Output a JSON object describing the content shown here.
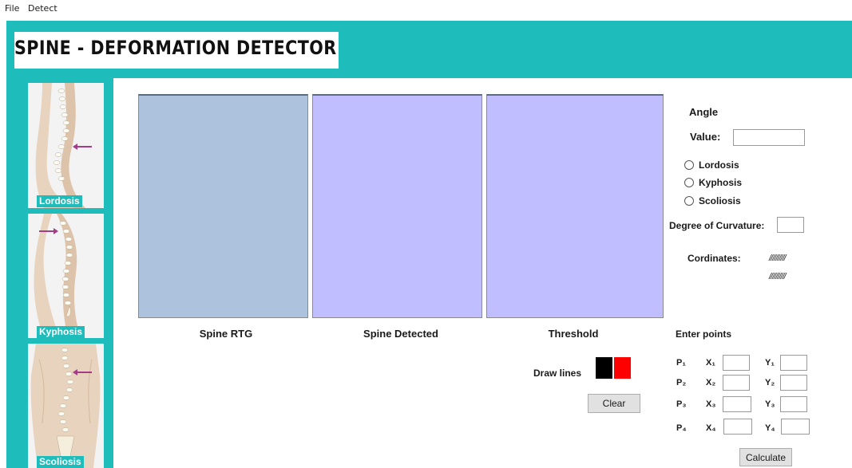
{
  "menu": [
    "File",
    "Detect"
  ],
  "app_title": "SPINE - DEFORMATION DETECTOR",
  "sidebar": [
    {
      "label": "Lordosis"
    },
    {
      "label": "Kyphosis"
    },
    {
      "label": "Scoliosis"
    }
  ],
  "images": [
    {
      "label": "Spine RTG",
      "color": "#adc2dc"
    },
    {
      "label": "Spine Detected",
      "color": "#c0beff"
    },
    {
      "label": "Threshold",
      "color": "#c0beff"
    }
  ],
  "angle": {
    "heading": "Angle",
    "value_label": "Value:",
    "value": "",
    "options": [
      "Lordosis",
      "Kyphosis",
      "Scoliosis"
    ],
    "curvature_label": "Degree of Curvature:",
    "curvature_value": "",
    "coordinates_label": "Cordinates:",
    "coordinates_values": [
      "//////////",
      "//////////"
    ]
  },
  "draw": {
    "label": "Draw lines",
    "colors": [
      "#000000",
      "#ff0000"
    ],
    "clear_label": "Clear"
  },
  "points": {
    "heading": "Enter points",
    "rows": [
      {
        "p": "P₁",
        "x": "X₁",
        "y": "Y₁",
        "xv": "",
        "yv": ""
      },
      {
        "p": "P₂",
        "x": "X₂",
        "y": "Y₂",
        "xv": "",
        "yv": ""
      },
      {
        "p": "P₃",
        "x": "X₃",
        "y": "Y₃",
        "xv": "",
        "yv": ""
      },
      {
        "p": "P₄",
        "x": "X₄",
        "y": "Y₄",
        "xv": "",
        "yv": ""
      }
    ],
    "calculate_label": "Calculate"
  },
  "colors": {
    "accent": "#1ebcbb",
    "illustration_bg": "#f3f3f3",
    "skin": "#e8d3bf",
    "arrow": "#a43d86"
  }
}
